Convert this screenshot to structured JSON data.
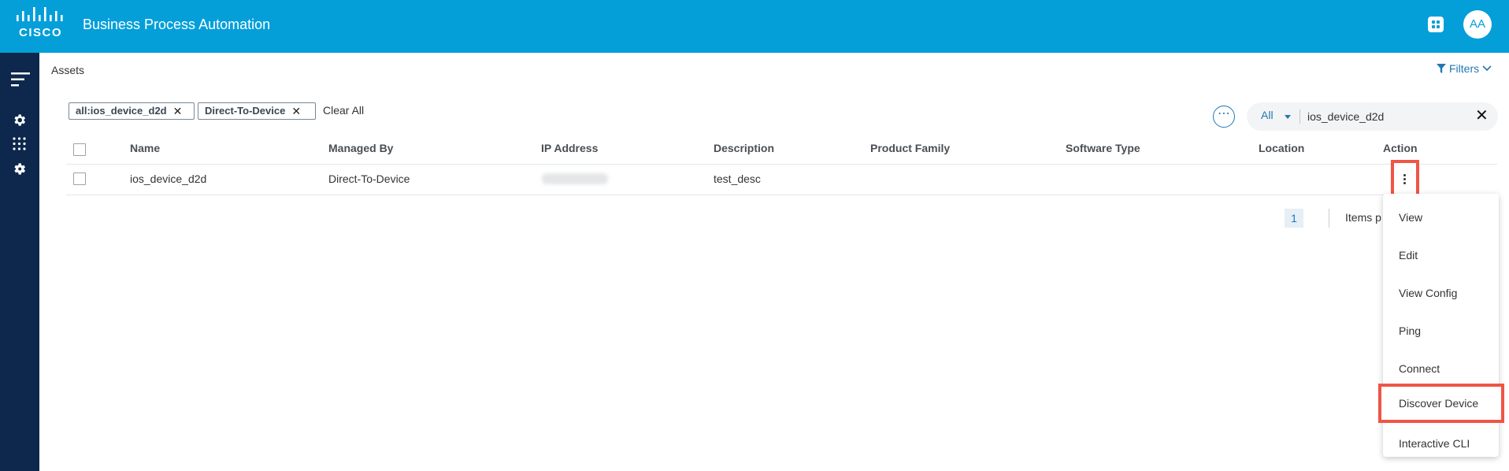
{
  "header": {
    "logo_text": "CISCO",
    "app_title": "Business Process Automation",
    "avatar_initials": "AA"
  },
  "breadcrumb": "Assets",
  "filters_label": "Filters",
  "chips": [
    {
      "label": "all:ios_device_d2d"
    },
    {
      "label": "Direct-To-Device"
    }
  ],
  "clear_all": "Clear All",
  "search": {
    "scope": "All",
    "value": "ios_device_d2d"
  },
  "table": {
    "columns": [
      "Name",
      "Managed By",
      "IP Address",
      "Description",
      "Product Family",
      "Software Type",
      "Location",
      "Action"
    ],
    "rows": [
      {
        "name": "ios_device_d2d",
        "managed_by": "Direct-To-Device",
        "description": "test_desc"
      }
    ]
  },
  "pagination": {
    "current_page": "1",
    "items_per_label": "Items p"
  },
  "action_menu": [
    "View",
    "Edit",
    "View Config",
    "Ping",
    "Connect",
    "Discover Device",
    "Interactive CLI"
  ],
  "colors": {
    "header": "#049fd9",
    "sidebar": "#0d274d",
    "accent": "#1f78b4",
    "highlight": "#f05545"
  }
}
